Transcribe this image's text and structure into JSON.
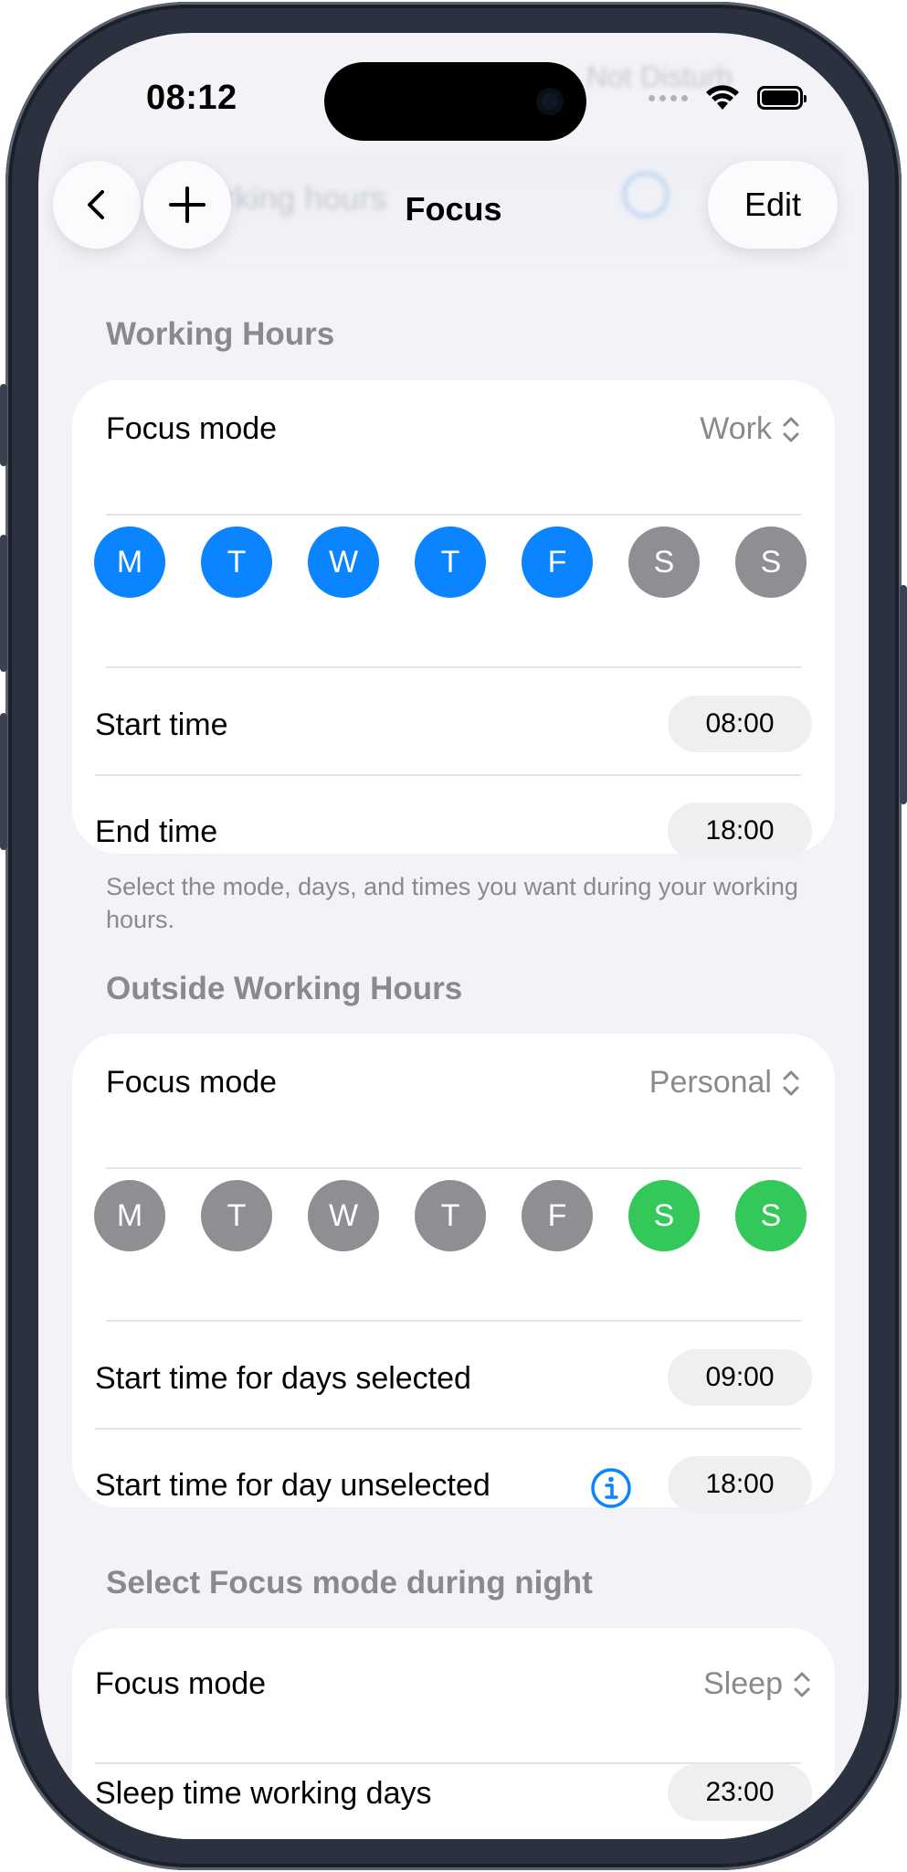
{
  "status_bar": {
    "time": "08:12"
  },
  "nav": {
    "title": "Focus",
    "edit_label": "Edit",
    "ghost_left_text": "Working hours",
    "ghost_top_right_text": "Not Disturb"
  },
  "working_hours": {
    "header": "Working Hours",
    "focus_mode_label": "Focus mode",
    "focus_mode_value": "Work",
    "days": [
      {
        "letter": "M",
        "selected": true
      },
      {
        "letter": "T",
        "selected": true
      },
      {
        "letter": "W",
        "selected": true
      },
      {
        "letter": "T",
        "selected": true
      },
      {
        "letter": "F",
        "selected": true
      },
      {
        "letter": "S",
        "selected": false
      },
      {
        "letter": "S",
        "selected": false
      }
    ],
    "start_time_label": "Start time",
    "start_time_value": "08:00",
    "end_time_label": "End time",
    "end_time_value": "18:00",
    "footnote": "Select the mode, days, and times you want during your working hours."
  },
  "outside_hours": {
    "header": "Outside Working Hours",
    "focus_mode_label": "Focus mode",
    "focus_mode_value": "Personal",
    "days": [
      {
        "letter": "M",
        "selected": false
      },
      {
        "letter": "T",
        "selected": false
      },
      {
        "letter": "W",
        "selected": false
      },
      {
        "letter": "T",
        "selected": false
      },
      {
        "letter": "F",
        "selected": false
      },
      {
        "letter": "S",
        "selected": true
      },
      {
        "letter": "S",
        "selected": true
      }
    ],
    "start_selected_label": "Start time for days selected",
    "start_selected_value": "09:00",
    "start_unselected_label": "Start time for day unselected",
    "start_unselected_value": "18:00"
  },
  "night": {
    "header": "Select Focus mode during night",
    "focus_mode_label": "Focus mode",
    "focus_mode_value": "Sleep",
    "sleep_working_label": "Sleep time working days",
    "sleep_working_value": "23:00"
  },
  "colors": {
    "accent_blue": "#0a84ff",
    "accent_green": "#34c759",
    "inactive_gray": "#8e8e93",
    "background": "#f2f2f7"
  },
  "icons": [
    "chevron-left-icon",
    "plus-icon",
    "info-icon",
    "updown-chevron-icon",
    "wifi-icon",
    "battery-icon"
  ]
}
